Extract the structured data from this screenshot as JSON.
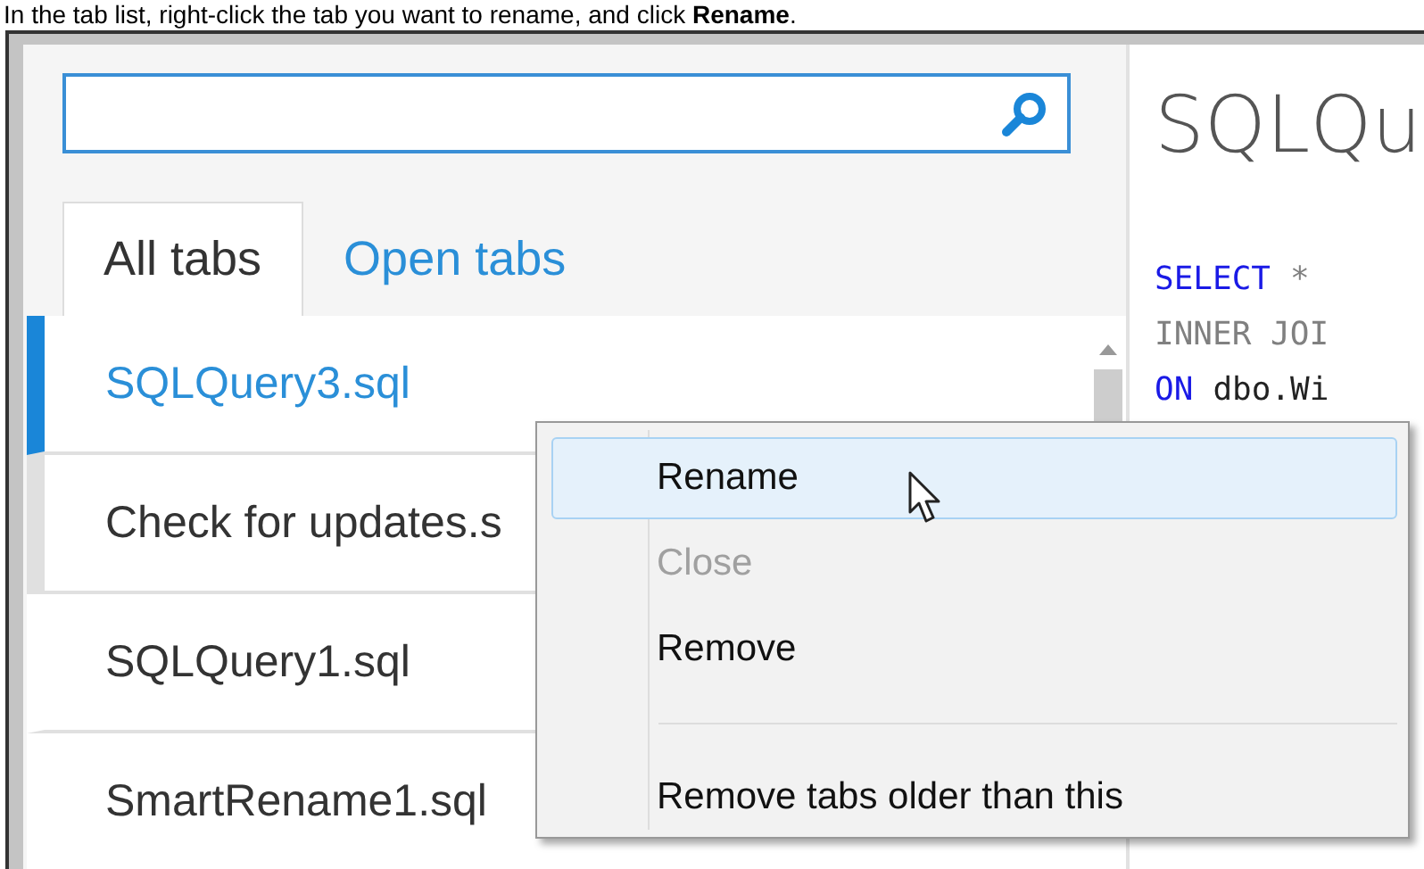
{
  "caption": "In the tab list, right-click the tab you want to rename, and click **Rename**.",
  "tabs": [
    {
      "label": "All tabs",
      "selected": true
    },
    {
      "label": "Open tabs",
      "selected": false
    }
  ],
  "tab_list": [
    {
      "name": "SQLQuery3.sql",
      "selected": true,
      "hovered": false
    },
    {
      "name": "Check for updates.s",
      "selected": false,
      "hovered": true
    },
    {
      "name": "SQLQuery1.sql",
      "selected": false,
      "hovered": false
    },
    {
      "name": "SmartRename1.sql",
      "selected": false,
      "hovered": false
    }
  ],
  "editor": {
    "title": "SQLQu",
    "code": [
      [
        {
          "kind": "keyword",
          "text": "SELECT"
        },
        {
          "kind": "operator",
          "text": "*"
        }
      ],
      [
        {
          "kind": "operator",
          "text": "INNER JOI"
        }
      ],
      [
        {
          "kind": "keyword",
          "text": "ON"
        },
        {
          "kind": "plain",
          "text": "dbo.Wi"
        }
      ]
    ]
  },
  "context_menu": [
    {
      "kind": "item",
      "label": "Rename",
      "selected": true,
      "disabled": false
    },
    {
      "kind": "item",
      "label": "Close",
      "selected": false,
      "disabled": true
    },
    {
      "kind": "item",
      "label": "Remove",
      "selected": false,
      "disabled": false
    },
    {
      "kind": "separator"
    },
    {
      "kind": "item",
      "label": "Remove tabs older than this",
      "selected": false,
      "disabled": false
    }
  ]
}
